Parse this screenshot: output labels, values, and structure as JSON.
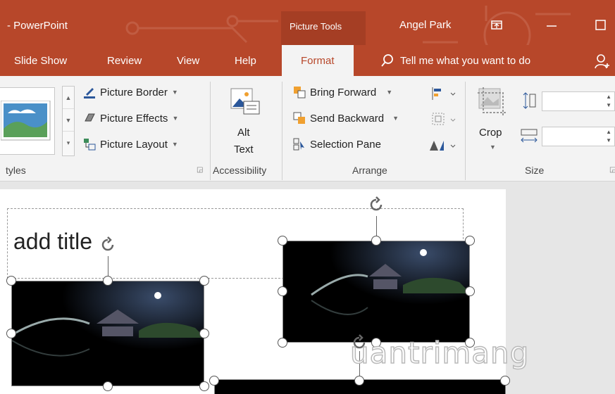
{
  "titlebar": {
    "app_name": "- PowerPoint",
    "context_tab": "Picture Tools",
    "user_name": "Angel Park",
    "controls": [
      "ribbon-display-icon",
      "minimize-icon",
      "maximize-icon"
    ]
  },
  "tabs": [
    {
      "label": "Slide Show"
    },
    {
      "label": "Review"
    },
    {
      "label": "View"
    },
    {
      "label": "Help"
    },
    {
      "label": "Format",
      "active": true
    }
  ],
  "tell_me": {
    "label": "Tell me what you want to do",
    "icon": "search-icon"
  },
  "ribbon": {
    "picture_styles": {
      "label": "tyles",
      "border": "Picture Border",
      "effects": "Picture Effects",
      "layout": "Picture Layout"
    },
    "accessibility": {
      "label": "Accessibility",
      "alt_line1": "Alt",
      "alt_line2": "Text"
    },
    "arrange": {
      "label": "Arrange",
      "bring_forward": "Bring Forward",
      "send_backward": "Send Backward",
      "selection_pane": "Selection Pane"
    },
    "size": {
      "label": "Size",
      "crop": "Crop",
      "height_value": "",
      "width_value": ""
    }
  },
  "slide": {
    "title_text": "add title"
  },
  "watermark": "uantrimang",
  "colors": {
    "accent": "#b7472a",
    "accent_dark": "#a53e24",
    "ribbon_bg": "#f3f3f3",
    "workspace_bg": "#e6e6e6"
  }
}
